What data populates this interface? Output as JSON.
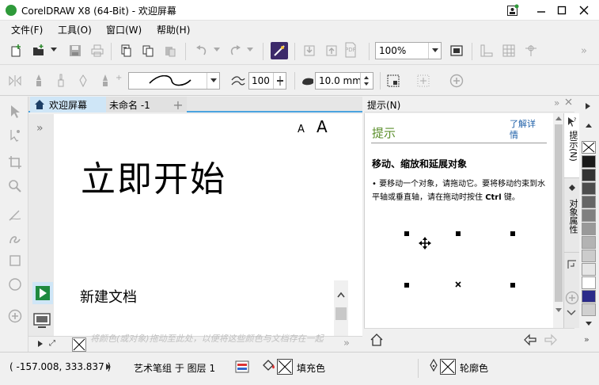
{
  "window": {
    "title": "CorelDRAW X8 (64-Bit) - 欢迎屏幕",
    "icons": [
      "coreldraw-logo-icon",
      "minimize-icon",
      "maximize-icon",
      "close-icon"
    ]
  },
  "menu": {
    "items": [
      {
        "label": "文件(F)"
      },
      {
        "label": "工具(O)"
      },
      {
        "label": "窗口(W)"
      },
      {
        "label": "帮助(H)"
      }
    ]
  },
  "toolbar": {
    "pdf_label": "PDF",
    "zoom_value": "100%"
  },
  "property_bar": {
    "smoothing_value": "100",
    "width_value": "10.0 mm"
  },
  "doc_tabs": [
    {
      "label": "欢迎屏幕",
      "active": true
    },
    {
      "label": "未命名 -1",
      "active": false
    }
  ],
  "welcome": {
    "font_small": "A",
    "font_large": "A",
    "heading": "立即开始",
    "new_doc": "新建文档",
    "hint_text": "将颜色(或对象)拖动至此处，以便将这些颜色与文档存在一起"
  },
  "hints_panel": {
    "header": "提示(N)",
    "title": "提示",
    "learn_more": "了解详情",
    "section_title": "移动、缩放和延展对象",
    "body_text": "• 要移动一个对象，请拖动它。要将移动约束到水平轴或垂直轴，请在拖动时按住",
    "body_key": "Ctrl",
    "body_tail": "键。"
  },
  "dock": {
    "tab1": "提示(N)",
    "tab2": "对象属性"
  },
  "status": {
    "coords": "( -157.008, 333.837 )",
    "layer_info": "艺术笔组 于 图层 1",
    "fill_label": "填充色",
    "outline_label": "轮廓色"
  },
  "palette": {
    "colors": [
      "#ffffff",
      "#1a1a1a",
      "#333333",
      "#4d4d4d",
      "#666666",
      "#808080",
      "#999999",
      "#b3b3b3",
      "#cccccc",
      "#e6e6e6",
      "#ffffff",
      "#2b2b8a",
      "#d0d0d0"
    ]
  }
}
